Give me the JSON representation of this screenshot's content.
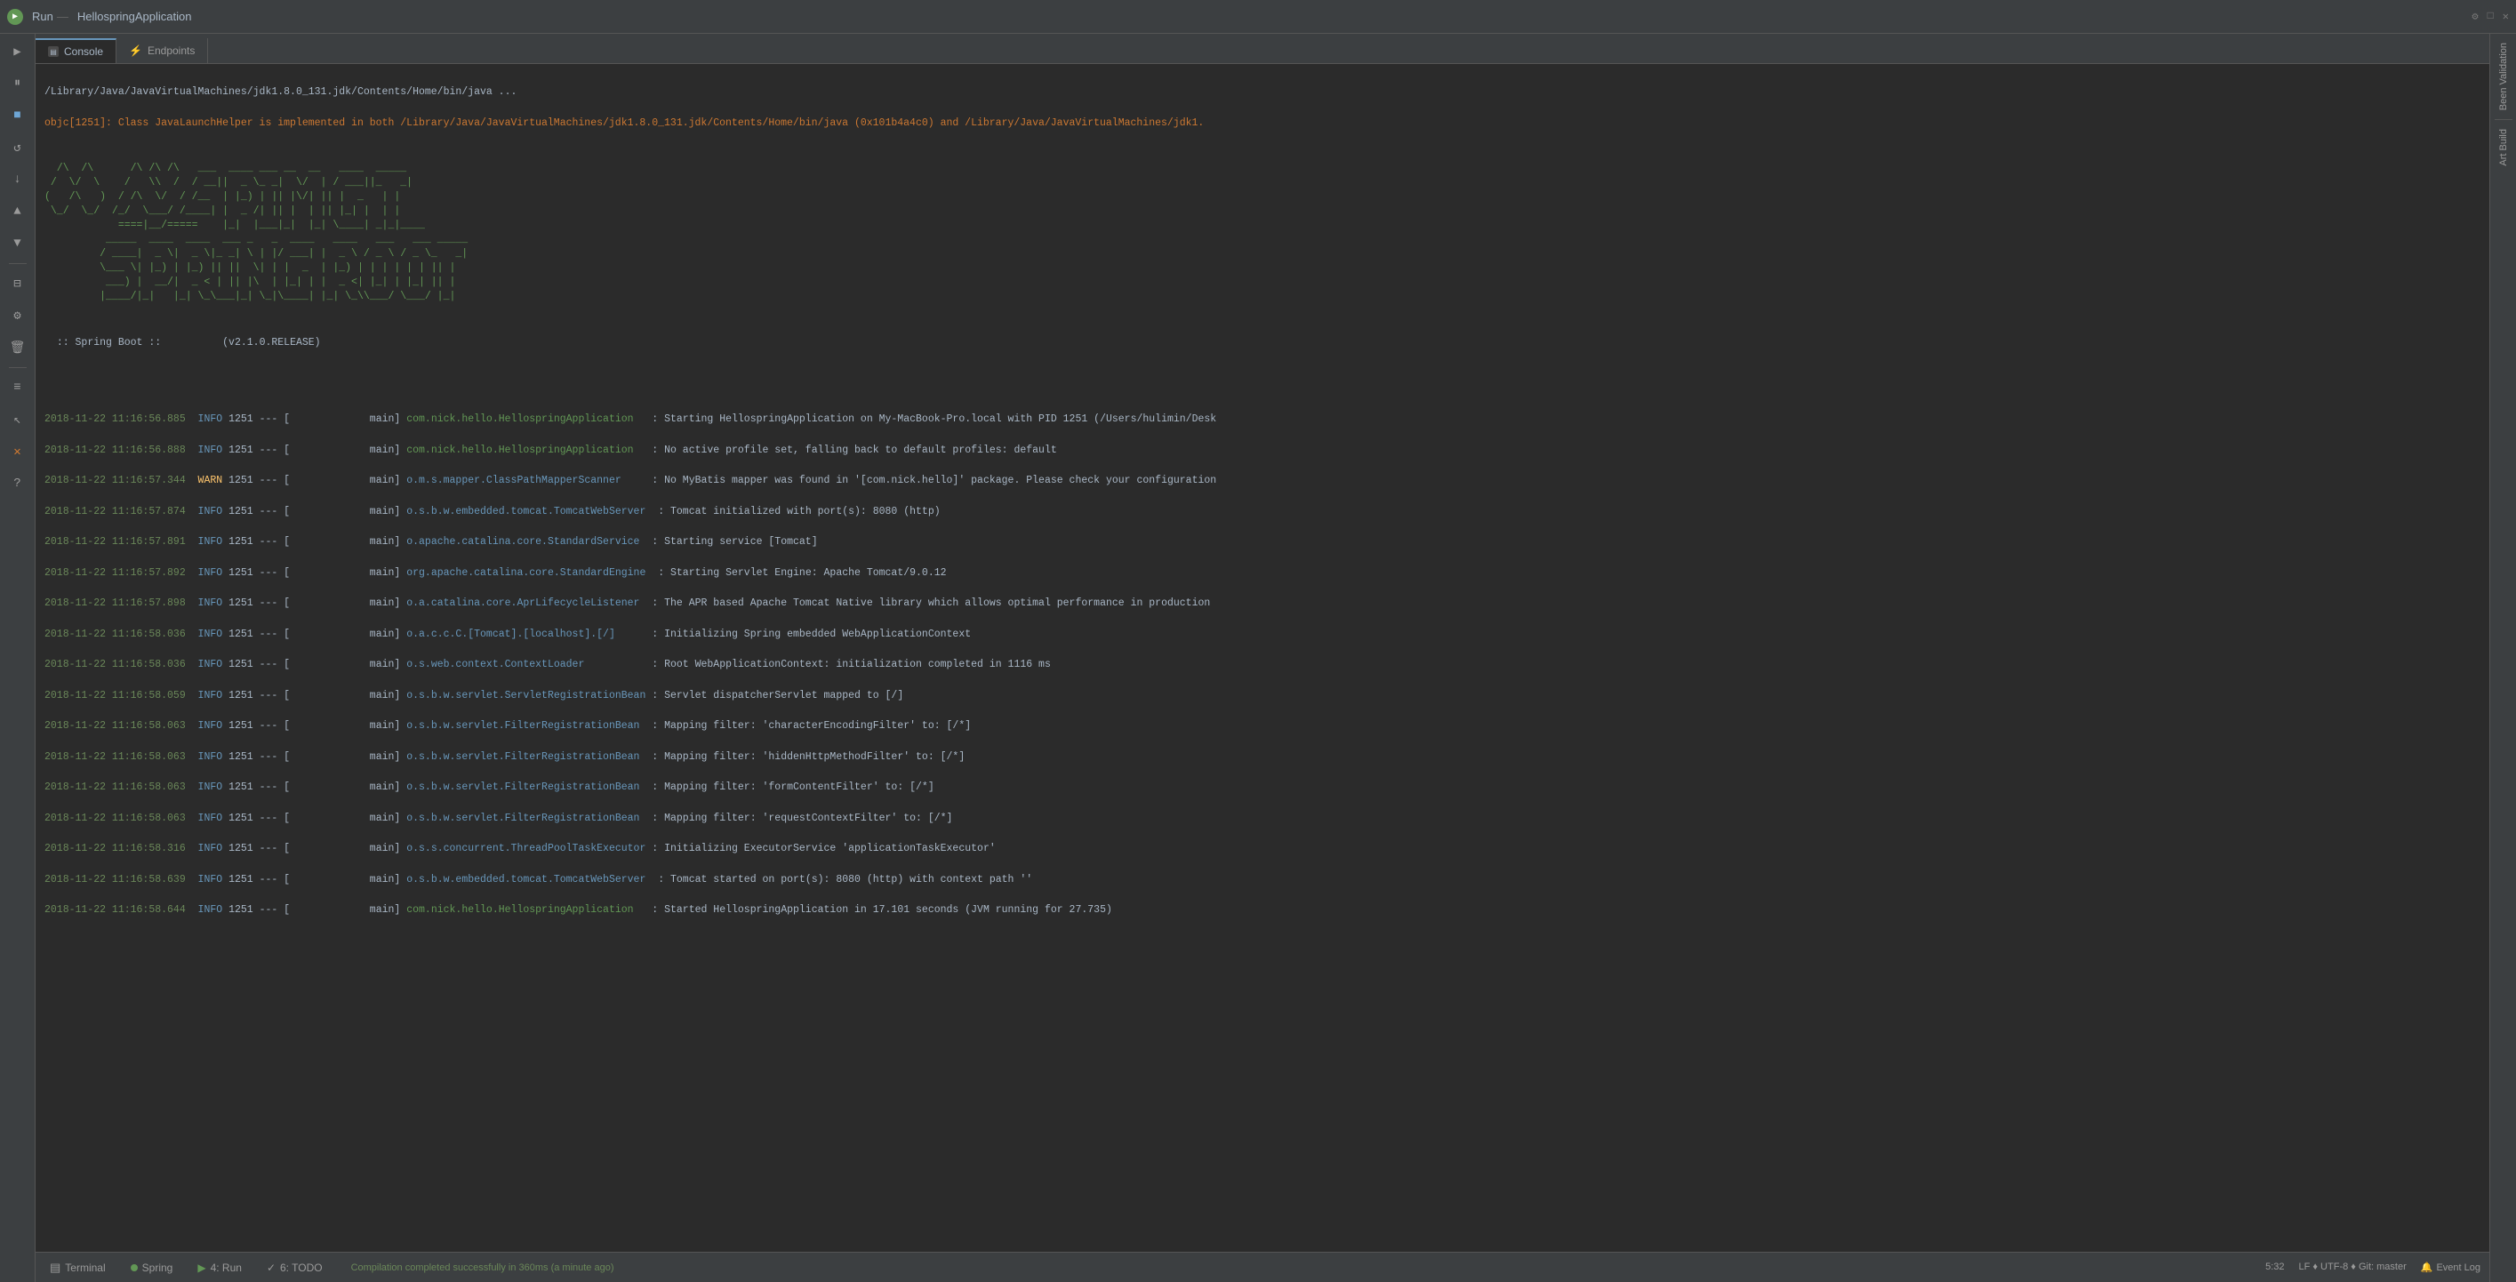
{
  "app": {
    "title": "HellospringApplication",
    "run_label": "Run"
  },
  "tabs": [
    {
      "id": "console",
      "label": "Console",
      "active": true
    },
    {
      "id": "endpoints",
      "label": "Endpoints",
      "active": false
    }
  ],
  "console": {
    "header_line1": "/Library/Java/JavaVirtualMachines/jdk1.8.0_131.jdk/Contents/Home/bin/java ...",
    "header_line2": "objc[1251]: Class JavaLaunchHelper is implemented in both /Library/Java/JavaVirtualMachines/jdk1.8.0_131.jdk/Contents/Home/bin/java (0x101b4a4c0) and /Library/Java/JavaVirtualMachines/jdk1.",
    "spring_version": "(v2.1.0.RELEASE)",
    "spring_boot_label": ":: Spring Boot ::",
    "log_entries": [
      {
        "ts": "2018-11-22 11:16:56.885",
        "level": "INFO",
        "pid": "1251",
        "sep": "---",
        "thread": "main",
        "class": "com.nick.hello.HellospringApplication",
        "msg": ": Starting HellospringApplication on My-MacBook-Pro.local with PID 1251 (/Users/hulimin/Desk"
      },
      {
        "ts": "2018-11-22 11:16:56.888",
        "level": "INFO",
        "pid": "1251",
        "sep": "---",
        "thread": "main",
        "class": "com.nick.hello.HellospringApplication",
        "msg": ": No active profile set, falling back to default profiles: default"
      },
      {
        "ts": "2018-11-22 11:16:57.344",
        "level": "WARN",
        "pid": "1251",
        "sep": "---",
        "thread": "main",
        "class": "o.m.s.mapper.ClassPathMapperScanner",
        "msg": ": No MyBatis mapper was found in '[com.nick.hello]' package. Please check your configuration"
      },
      {
        "ts": "2018-11-22 11:16:57.874",
        "level": "INFO",
        "pid": "1251",
        "sep": "---",
        "thread": "main",
        "class": "o.s.b.w.embedded.tomcat.TomcatWebServer",
        "msg": ": Tomcat initialized with port(s): 8080 (http)"
      },
      {
        "ts": "2018-11-22 11:16:57.891",
        "level": "INFO",
        "pid": "1251",
        "sep": "---",
        "thread": "main",
        "class": "o.apache.catalina.core.StandardService",
        "msg": ": Starting service [Tomcat]"
      },
      {
        "ts": "2018-11-22 11:16:57.892",
        "level": "INFO",
        "pid": "1251",
        "sep": "---",
        "thread": "main",
        "class": "org.apache.catalina.core.StandardEngine",
        "msg": ": Starting Servlet Engine: Apache Tomcat/9.0.12"
      },
      {
        "ts": "2018-11-22 11:16:57.898",
        "level": "INFO",
        "pid": "1251",
        "sep": "---",
        "thread": "main",
        "class": "o.a.catalina.core.AprLifecycleListener",
        "msg": ": The APR based Apache Tomcat Native library which allows optimal performance in production"
      },
      {
        "ts": "2018-11-22 11:16:58.036",
        "level": "INFO",
        "pid": "1251",
        "sep": "---",
        "thread": "main",
        "class": "o.a.c.c.C.[Tomcat].[localhost].[/]",
        "msg": ": Initializing Spring embedded WebApplicationContext"
      },
      {
        "ts": "2018-11-22 11:16:58.036",
        "level": "INFO",
        "pid": "1251",
        "sep": "---",
        "thread": "main",
        "class": "o.s.web.context.ContextLoader",
        "msg": ": Root WebApplicationContext: initialization completed in 1116 ms"
      },
      {
        "ts": "2018-11-22 11:16:58.059",
        "level": "INFO",
        "pid": "1251",
        "sep": "---",
        "thread": "main",
        "class": "o.s.b.w.servlet.ServletRegistrationBean",
        "msg": ": Servlet dispatcherServlet mapped to [/]"
      },
      {
        "ts": "2018-11-22 11:16:58.063",
        "level": "INFO",
        "pid": "1251",
        "sep": "---",
        "thread": "main",
        "class": "o.s.b.w.servlet.FilterRegistrationBean",
        "msg": ": Mapping filter: 'characterEncodingFilter' to: [/*]"
      },
      {
        "ts": "2018-11-22 11:16:58.063",
        "level": "INFO",
        "pid": "1251",
        "sep": "---",
        "thread": "main",
        "class": "o.s.b.w.servlet.FilterRegistrationBean",
        "msg": ": Mapping filter: 'hiddenHttpMethodFilter' to: [/*]"
      },
      {
        "ts": "2018-11-22 11:16:58.063",
        "level": "INFO",
        "pid": "1251",
        "sep": "---",
        "thread": "main",
        "class": "o.s.b.w.servlet.FilterRegistrationBean",
        "msg": ": Mapping filter: 'formContentFilter' to: [/*]"
      },
      {
        "ts": "2018-11-22 11:16:58.063",
        "level": "INFO",
        "pid": "1251",
        "sep": "---",
        "thread": "main",
        "class": "o.s.b.w.servlet.FilterRegistrationBean",
        "msg": ": Mapping filter: 'requestContextFilter' to: [/*]"
      },
      {
        "ts": "2018-11-22 11:16:58.316",
        "level": "INFO",
        "pid": "1251",
        "sep": "---",
        "thread": "main",
        "class": "o.s.s.concurrent.ThreadPoolTaskExecutor",
        "msg": ": Initializing ExecutorService 'applicationTaskExecutor'"
      },
      {
        "ts": "2018-11-22 11:16:58.639",
        "level": "INFO",
        "pid": "1251",
        "sep": "---",
        "thread": "main",
        "class": "o.s.b.w.embedded.tomcat.TomcatWebServer",
        "msg": ": Tomcat started on port(s): 8080 (http) with context path ''"
      },
      {
        "ts": "2018-11-22 11:16:58.644",
        "level": "INFO",
        "pid": "1251",
        "sep": "---",
        "thread": "main",
        "class": "com.nick.hello.HellospringApplication",
        "msg": ": Started HellospringApplication in 17.101 seconds (JVM running for 27.735)"
      }
    ]
  },
  "bottom": {
    "terminal_label": "Terminal",
    "spring_label": "Spring",
    "run_tab_label": "4: Run",
    "todo_label": "6: TODO",
    "status_text": "Compilation completed successfully in 360ms (a minute ago)",
    "time": "5:32",
    "event_log_label": "Event Log"
  },
  "right_sidebar": {
    "items": [
      "Been Validation",
      "Art Build"
    ]
  },
  "icons": {
    "play": "▶",
    "stop": "■",
    "rerun": "↺",
    "scroll_end": "↓",
    "pause": "⏸",
    "up": "▲",
    "down": "▼",
    "filter": "⊟",
    "clear": "🗑",
    "settings": "⚙",
    "close": "✕",
    "question": "?",
    "cursor": "↖",
    "bug": "🐛",
    "bookmark": "🔖",
    "list": "≡"
  }
}
